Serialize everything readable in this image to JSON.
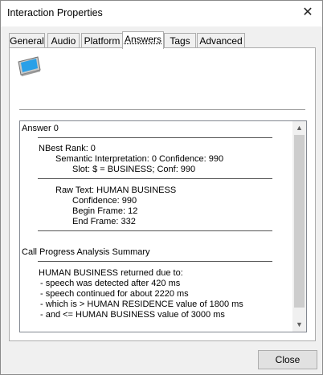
{
  "window": {
    "title": "Interaction Properties",
    "close_glyph": "✕"
  },
  "tabs": [
    {
      "label": "General"
    },
    {
      "label": "Audio"
    },
    {
      "label": "Platform"
    },
    {
      "label": "Answers"
    },
    {
      "label": "Tags"
    },
    {
      "label": "Advanced"
    }
  ],
  "active_tab": "Answers",
  "icon": {
    "name": "monitor-icon"
  },
  "answers": {
    "heading": "Answer 0",
    "nbest": "NBest Rank: 0",
    "semantic": "Semantic Interpretation: 0 Confidence: 990",
    "slot": "Slot: $ = BUSINESS; Conf: 990",
    "raw_text": "Raw Text: HUMAN BUSINESS",
    "confidence": "Confidence: 990",
    "begin_frame": "Begin Frame: 12",
    "end_frame": "End Frame: 332",
    "cpa_heading": "Call Progress Analysis Summary",
    "cpa_result": "HUMAN BUSINESS returned due to:",
    "cpa_lines": [
      "- speech was detected after 420 ms",
      "- speech continued for about 2220 ms",
      "- which is > HUMAN RESIDENCE value of 1800 ms",
      "- and <= HUMAN BUSINESS value of 3000 ms"
    ]
  },
  "buttons": {
    "close_label": "Close"
  },
  "scroll": {
    "up_glyph": "▲",
    "down_glyph": "▼"
  },
  "colors": {
    "thumb": "#cdcdcd",
    "icon_screen": "#2aa0e8"
  }
}
